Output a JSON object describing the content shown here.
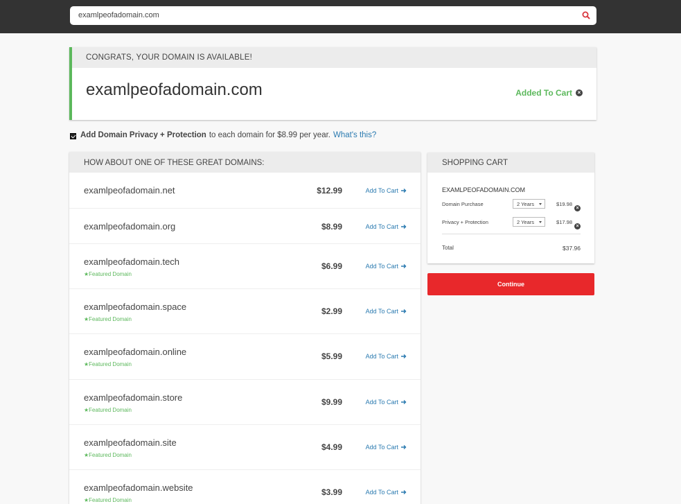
{
  "search": {
    "value": "examlpeofadomain.com",
    "icon": "search-icon",
    "icon_color": "#d9363e"
  },
  "congrats": {
    "heading": "CONGRATS, YOUR DOMAIN IS AVAILABLE!",
    "domain": "examlpeofadomain.com",
    "added_label": "Added To Cart",
    "accent_color": "#5cb85c"
  },
  "privacy": {
    "checked": true,
    "bold_text": "Add Domain Privacy + Protection",
    "text": "to each domain for $8.99 per year.",
    "link": "What's this?"
  },
  "suggestions": {
    "heading": "HOW ABOUT ONE OF THESE GREAT DOMAINS:",
    "add_label": "Add To Cart",
    "items": [
      {
        "name": "examlpeofadomain.net",
        "price": "$12.99",
        "featured": ""
      },
      {
        "name": "examlpeofadomain.org",
        "price": "$8.99",
        "featured": ""
      },
      {
        "name": "examlpeofadomain.tech",
        "price": "$6.99",
        "featured": "★Featured Domain"
      },
      {
        "name": "examlpeofadomain.space",
        "price": "$2.99",
        "featured": "★Featured Domain"
      },
      {
        "name": "examlpeofadomain.online",
        "price": "$5.99",
        "featured": "★Featured Domain"
      },
      {
        "name": "examlpeofadomain.store",
        "price": "$9.99",
        "featured": "★Featured Domain"
      },
      {
        "name": "examlpeofadomain.site",
        "price": "$4.99",
        "featured": "★Featured Domain"
      },
      {
        "name": "examlpeofadomain.website",
        "price": "$3.99",
        "featured": "★Featured Domain"
      }
    ]
  },
  "cart": {
    "heading": "SHOPPING CART",
    "domain": "EXAMLPEOFADOMAIN.COM",
    "lines": [
      {
        "label": "Domain Purchase",
        "term": "2 Years",
        "amount": "$19.98"
      },
      {
        "label": "Privacy + Protection",
        "term": "2 Years",
        "amount": "$17.98"
      }
    ],
    "total_label": "Total",
    "total_value": "$37.96"
  },
  "continue_label": "Continue",
  "colors": {
    "topbar": "#333333",
    "link": "#2a7ab0",
    "continue": "#e8282b"
  }
}
